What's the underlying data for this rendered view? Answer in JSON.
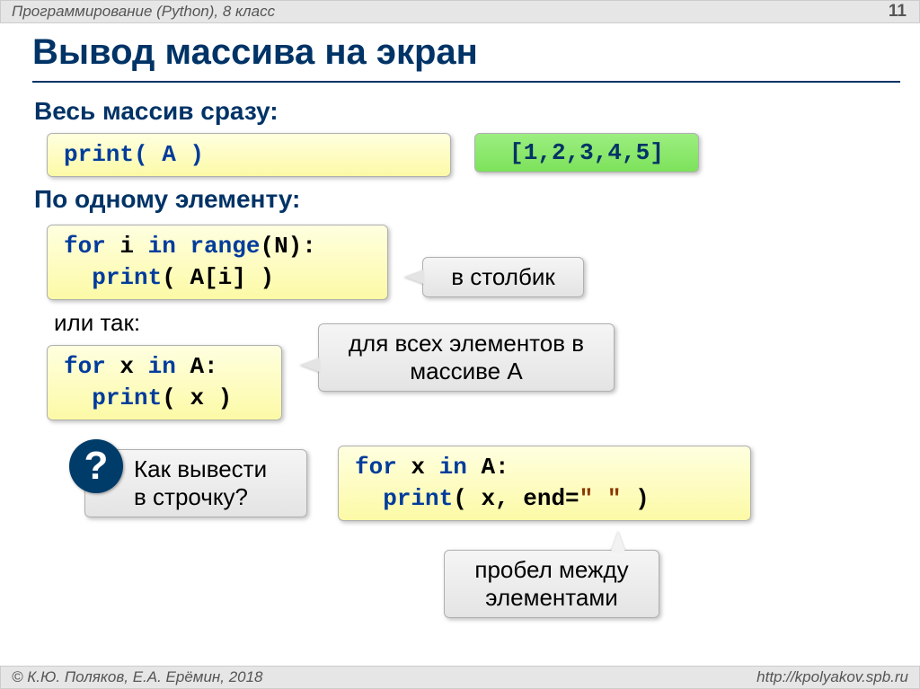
{
  "header": {
    "course": "Программирование (Python), 8 класс",
    "page": "11"
  },
  "title": "Вывод массива на экран",
  "section1": {
    "label": "Весь массив сразу:",
    "code": "print( A )",
    "output": "[1,2,3,4,5]"
  },
  "section2": {
    "label": "По одному элементу:",
    "code_line1_kw1": "for",
    "code_line1_txt1": " i ",
    "code_line1_kw2": "in",
    "code_line1_txt2": " ",
    "code_line1_kw3": "range",
    "code_line1_txt3": "(N):",
    "code_line2_indent": "  ",
    "code_line2_kw": "print",
    "code_line2_txt": "( A[i] )",
    "callout": "в столбик"
  },
  "section3": {
    "label": "или так:",
    "code_line1_kw1": "for",
    "code_line1_txt1": " x ",
    "code_line1_kw2": "in",
    "code_line1_txt2": " A:",
    "code_line2_indent": "  ",
    "code_line2_kw": "print",
    "code_line2_txt": "( x )",
    "callout_l1": "для всех элементов в",
    "callout_l2": "массиве A"
  },
  "question": {
    "mark": "?",
    "line1": "Как вывести",
    "line2": "в строчку?"
  },
  "answer": {
    "code_line1_kw1": "for",
    "code_line1_txt1": " x ",
    "code_line1_kw2": "in",
    "code_line1_txt2": " A:",
    "code_line2_indent": "  ",
    "code_line2_kw": "print",
    "code_line2_txt1": "( x, end=",
    "code_line2_str": "\" \"",
    "code_line2_txt2": " )",
    "callout_l1": "пробел между",
    "callout_l2": "элементами"
  },
  "footer": {
    "authors": "© К.Ю. Поляков, Е.А. Ерёмин, 2018",
    "url": "http://kpolyakov.spb.ru"
  }
}
